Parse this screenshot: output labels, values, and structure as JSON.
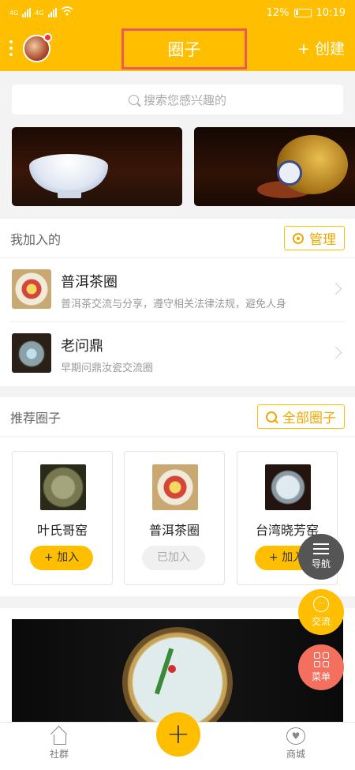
{
  "status": {
    "net1": "4G",
    "net2": "4G",
    "battery": "12%",
    "time": "10:19"
  },
  "header": {
    "title": "圈子",
    "create_label": "+ 创建"
  },
  "search": {
    "placeholder": "搜索您感兴趣的"
  },
  "joined": {
    "heading": "我加入的",
    "manage_label": "管理",
    "items": [
      {
        "name": "普洱茶圈",
        "desc": "普洱茶交流与分享，遵守相关法律法规，避免人身"
      },
      {
        "name": "老问鼎",
        "desc": "早期问鼎汝瓷交流圈"
      }
    ]
  },
  "recommend": {
    "heading": "推荐圈子",
    "all_label": "全部圈子",
    "cards": [
      {
        "name": "叶氏哥窑",
        "button": "+ 加入"
      },
      {
        "name": "普洱茶圈",
        "button": "已加入"
      },
      {
        "name": "台湾晓芳窑",
        "button": "+ 加入"
      }
    ]
  },
  "fabs": {
    "nav": "导航",
    "chat": "交流",
    "menu": "菜单"
  },
  "tabbar": {
    "home": "社群",
    "mall": "商城",
    "plus": "+"
  },
  "colors": {
    "accent": "#ffbf00",
    "highlight_box": "#ee5a5a",
    "menu_fab": "#f4705e",
    "nav_fab": "#555555"
  }
}
